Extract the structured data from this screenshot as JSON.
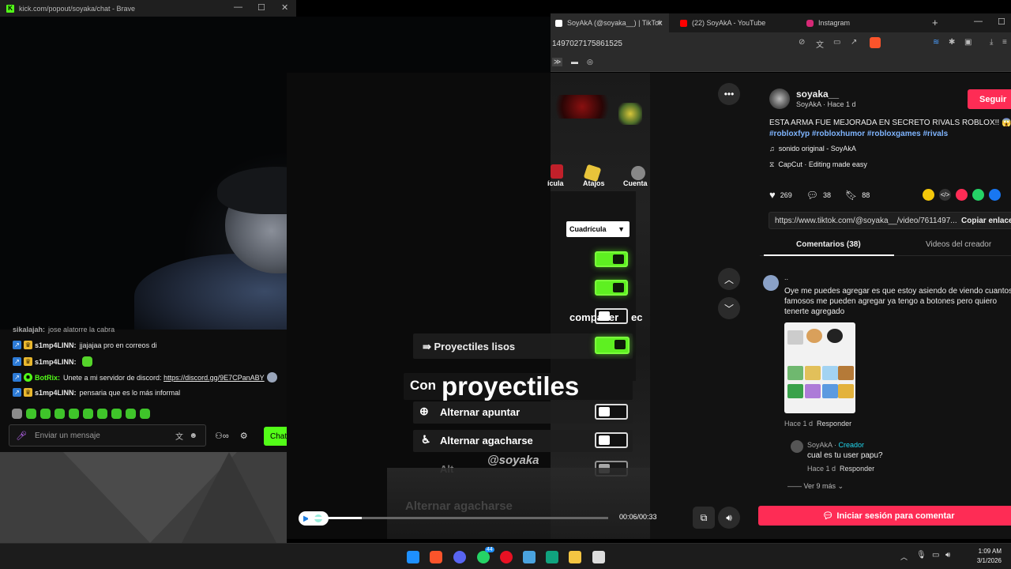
{
  "kick_window": {
    "title": "kick.com/popout/soyaka/chat - Brave",
    "chat": {
      "messages": [
        {
          "user": "sikalajah:",
          "text": "jose alatorre la cabra"
        },
        {
          "user": "s1mp4LINN:",
          "text": "jjajajaa pro en correos di"
        },
        {
          "user": "s1mp4LINN:",
          "text": ""
        },
        {
          "user": "BotRix:",
          "text": "Unete a mi servidor de discord:",
          "link": "https://discord.gg/9E7CPanABY"
        },
        {
          "user": "s1mp4LINN:",
          "text": "pensaria que es lo más informal"
        }
      ],
      "input_placeholder": "Enviar un mensaje",
      "chat_button": "Chat"
    }
  },
  "browser": {
    "tabs": [
      {
        "label": "SoyAkA (@soyaka__) | TikTok",
        "active": true,
        "color": "#ffffff"
      },
      {
        "label": "(22) SoyAkA - YouTube",
        "active": false,
        "color": "#ff0000"
      },
      {
        "label": "Instagram",
        "active": false,
        "color": "#d62976"
      }
    ],
    "address": "1497027175861525"
  },
  "video": {
    "overlay": {
      "dropdown": "Cuadrícula",
      "top_icons": [
        "ícula",
        "Atajos",
        "Cuenta"
      ],
      "row_partial": "compañer",
      "row_partial_right": "ec",
      "row_highlight": "Proyectiles lisos",
      "caption_small": "Con",
      "caption_big": "proyectiles",
      "rows": [
        "Alternar apuntar",
        "Alternar agacharse"
      ],
      "row_ghost": "Alternar agacharse",
      "row_cut": "Alt",
      "watermark": "@soyaka"
    },
    "time": "00:06/00:33",
    "progress": 0.18
  },
  "details": {
    "username": "soyaka__",
    "subtitle": "SoyAkA · Hace 1 d",
    "follow_label": "Seguir",
    "caption": "ESTA ARMA FUE MEJORADA EN SECRETO RIVALS ROBLOX!! 😱",
    "hashtags": "#robloxfyp #robloxhumor #robloxgames #rivals",
    "sound": "sonido original - SoyAkA",
    "capcut": "CapCut · Editing made easy",
    "likes": "269",
    "comments_count": "38",
    "saves": "88",
    "url": "https://www.tiktok.com/@soyaka__/video/7611497...",
    "copy_label": "Copiar enlace",
    "tab_comments": "Comentarios (38)",
    "tab_videos": "Videos del creador",
    "comment": {
      "user": "..",
      "text": "Oye me puedes agregar es que estoy asiendo de viendo cuantos famosos me pueden agregar ya tengo a botones pero quiero tenerte agregado",
      "meta": "Hace 1 d",
      "reply_label": "Responder"
    },
    "reply": {
      "user": "SoyAkA",
      "badge": "Creador",
      "text": "cual es tu user papu?",
      "meta": "Hace 1 d",
      "reply_label": "Responder"
    },
    "see_more": "Ver 9 más",
    "login_label": "Iniciar sesión para comentar"
  },
  "taskbar": {
    "time": "1:09 AM",
    "date": "3/1/2026",
    "whatsapp_badge": "44"
  },
  "colors": {
    "kick_green": "#53fc18",
    "tiktok_red": "#fe2c55"
  }
}
